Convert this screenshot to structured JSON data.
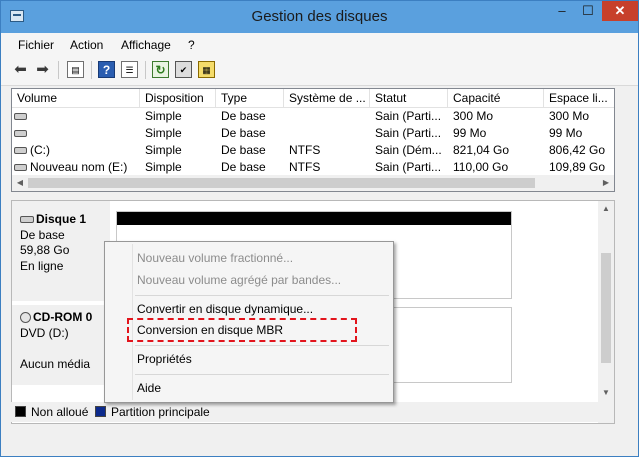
{
  "window": {
    "title": "Gestion des disques",
    "controls": {
      "minimize": "–",
      "maximize": "☐",
      "close": "✕"
    }
  },
  "menubar": [
    "Fichier",
    "Action",
    "Affichage",
    "?"
  ],
  "toolbar": {
    "icons": [
      "back-arrow-icon",
      "forward-arrow-icon",
      "console-icon",
      "help-icon",
      "list-view-icon",
      "refresh-icon",
      "properties-icon",
      "volume-icon"
    ],
    "help_glyph": "?"
  },
  "volume_table": {
    "headers": [
      "Volume",
      "Disposition",
      "Type",
      "Système de ...",
      "Statut",
      "Capacité",
      "Espace li..."
    ],
    "rows": [
      [
        "",
        "Simple",
        "De base",
        "",
        "Sain (Parti...",
        "300 Mo",
        "300 Mo"
      ],
      [
        "",
        "Simple",
        "De base",
        "",
        "Sain (Parti...",
        "99 Mo",
        "99 Mo"
      ],
      [
        "(C:)",
        "Simple",
        "De base",
        "NTFS",
        "Sain (Dém...",
        "821,04 Go",
        "806,42 Go"
      ],
      [
        "Nouveau nom (E:)",
        "Simple",
        "De base",
        "NTFS",
        "Sain (Parti...",
        "110,00 Go",
        "109,89 Go"
      ]
    ]
  },
  "disks": [
    {
      "name": "Disque 1",
      "type": "De base",
      "size": "59,88 Go",
      "status": "En ligne"
    },
    {
      "name": "CD-ROM 0",
      "type": "DVD (D:)",
      "status": "Aucun média"
    }
  ],
  "legend": [
    {
      "label": "Non alloué",
      "color": "#000000"
    },
    {
      "label": "Partition principale",
      "color": "#0c2a8c"
    }
  ],
  "context_menu": {
    "items": [
      {
        "label": "Nouveau volume fractionné...",
        "enabled": false
      },
      {
        "label": "Nouveau volume agrégé par bandes...",
        "enabled": false
      },
      {
        "label": "Convertir en disque dynamique...",
        "enabled": true
      },
      {
        "label": "Conversion en disque MBR",
        "enabled": true
      },
      {
        "label": "Propriétés",
        "enabled": true
      },
      {
        "label": "Aide",
        "enabled": true
      }
    ],
    "highlight_color": "#e2141c"
  }
}
